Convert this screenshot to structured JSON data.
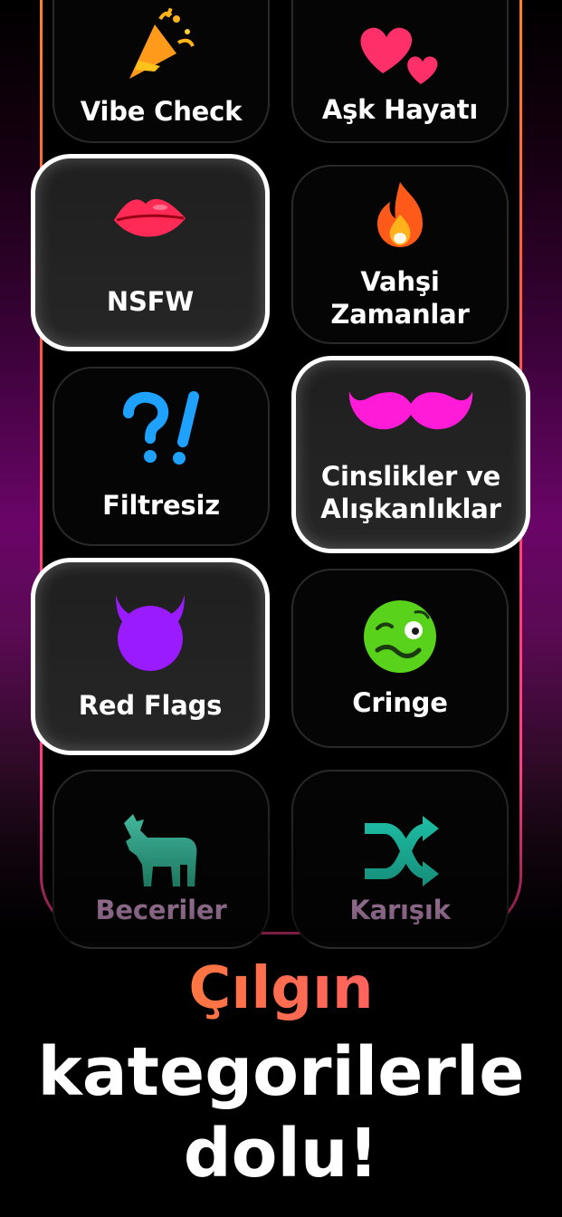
{
  "categories": [
    {
      "label": "Vibe Check",
      "icon": "party-popper-icon",
      "selected": false
    },
    {
      "label": "Aşk Hayatı",
      "icon": "hearts-icon",
      "selected": false
    },
    {
      "label": "NSFW",
      "icon": "lips-icon",
      "selected": true
    },
    {
      "label_line1": "Vahşi",
      "label_line2": "Zamanlar",
      "icon": "fire-icon",
      "selected": false
    },
    {
      "label": "Filtresiz",
      "icon": "question-exclamation-icon",
      "selected": false
    },
    {
      "label_line1": "Cinslikler ve",
      "label_line2": "Alışkanlıklar",
      "icon": "mustache-icon",
      "selected": true
    },
    {
      "label": "Red Flags",
      "icon": "devil-icon",
      "selected": true
    },
    {
      "label": "Cringe",
      "icon": "woozy-face-icon",
      "selected": false
    },
    {
      "label": "Beceriler",
      "icon": "goat-icon",
      "selected": false
    },
    {
      "label": "Karışık",
      "icon": "shuffle-icon",
      "selected": false
    }
  ],
  "headline": {
    "accent": "Çılgın",
    "line2": "kategorilerle",
    "line3": "dolu!"
  },
  "colors": {
    "frame_gradient_start": "#ff8a25",
    "frame_gradient_end": "#ff3c8a",
    "accent_text_start": "#ff8a25",
    "accent_text_end": "#ff4f7a",
    "lips": "#ff2a55",
    "devil": "#9a1bff",
    "mustache": "#ff1bd8",
    "woozy": "#58d21a",
    "goat": "#42d6b7",
    "shuffle": "#22e0c2"
  }
}
